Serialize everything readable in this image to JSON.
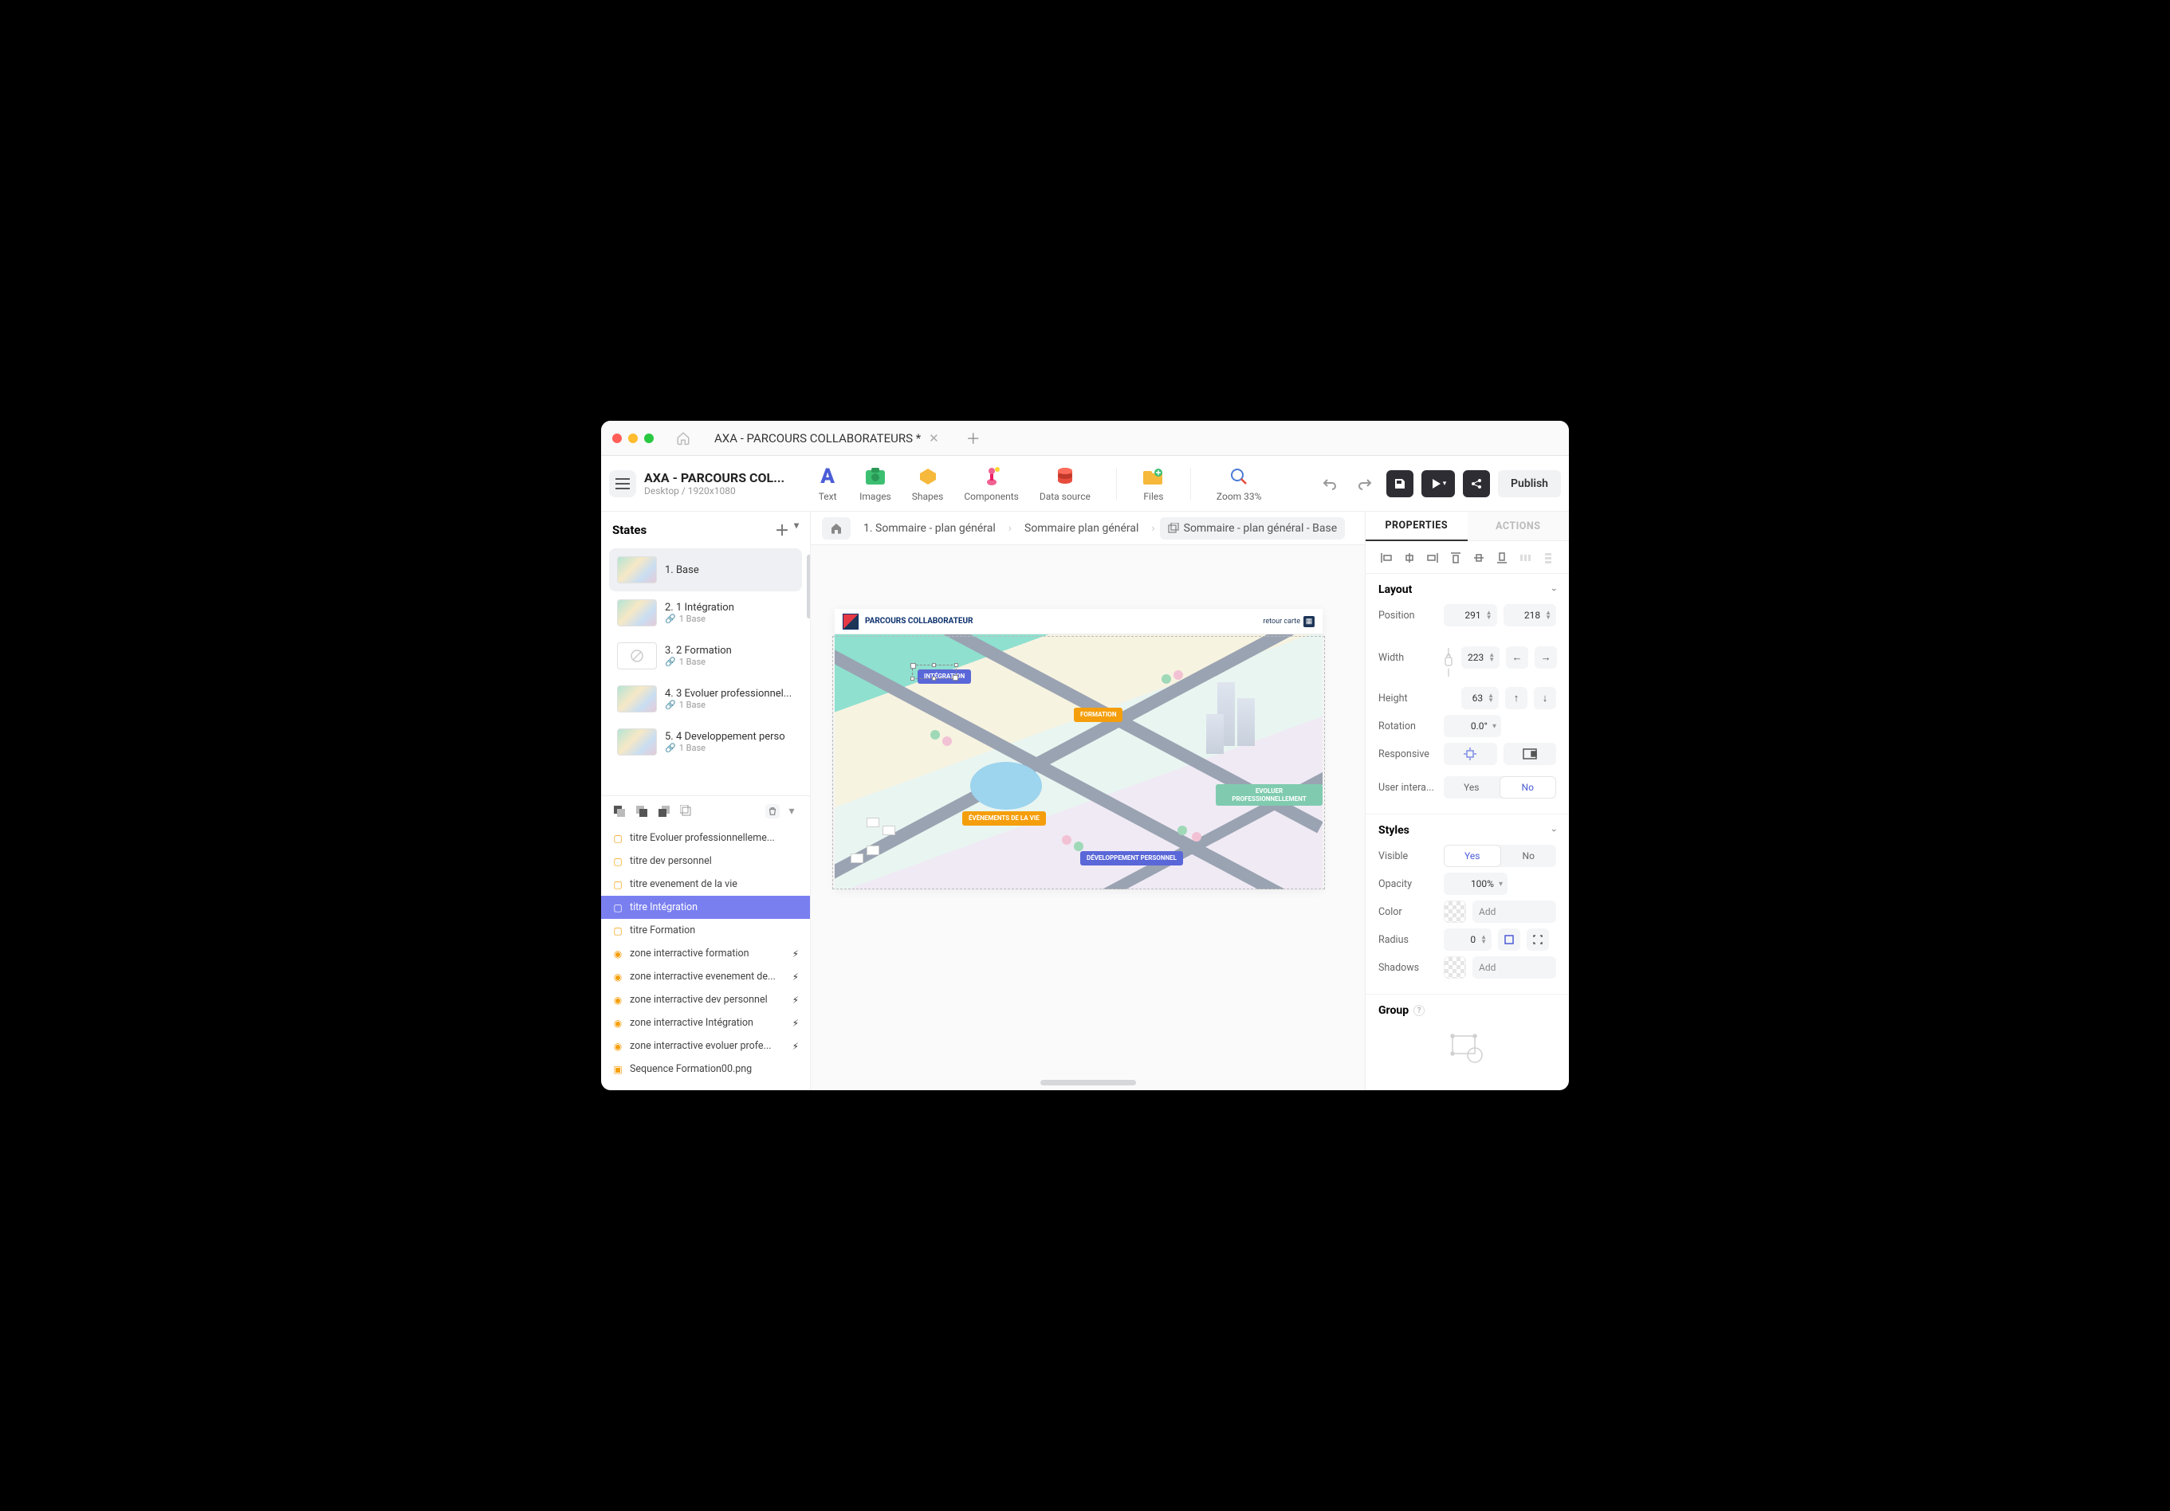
{
  "titlebar": {
    "tab_title": "AXA - PARCOURS COLLABORATEURS *"
  },
  "doc": {
    "title": "AXA - PARCOURS COL...",
    "subtitle": "Desktop / 1920x1080"
  },
  "tools": {
    "text": "Text",
    "images": "Images",
    "shapes": "Shapes",
    "components": "Components",
    "datasource": "Data source",
    "files": "Files",
    "zoom": "Zoom 33%",
    "publish": "Publish"
  },
  "breadcrumb": {
    "a": "1. Sommaire - plan général",
    "b": "Sommaire plan général",
    "c": "Sommaire - plan général  -  Base"
  },
  "states": {
    "heading": "States",
    "items": [
      {
        "name": "1. Base",
        "sub": "",
        "thumb": "map"
      },
      {
        "name": "2. 1 Intégration",
        "sub": "1  Base",
        "thumb": "map"
      },
      {
        "name": "3. 2 Formation",
        "sub": "1  Base",
        "thumb": "empty"
      },
      {
        "name": "4. 3 Evoluer professionnel...",
        "sub": "1  Base",
        "thumb": "map"
      },
      {
        "name": "5. 4 Developpement perso",
        "sub": "1  Base",
        "thumb": "map"
      }
    ]
  },
  "layers": [
    {
      "icon": "box",
      "name": "titre Evoluer professionnelleme..."
    },
    {
      "icon": "box",
      "name": "titre dev personnel"
    },
    {
      "icon": "box",
      "name": "titre evenement de la vie"
    },
    {
      "icon": "box",
      "name": "titre Intégration",
      "selected": true
    },
    {
      "icon": "box",
      "name": "titre Formation"
    },
    {
      "icon": "flame",
      "name": "zone interractive formation",
      "bolt": true
    },
    {
      "icon": "flame",
      "name": "zone interractive evenement de...",
      "bolt": true
    },
    {
      "icon": "flame",
      "name": "zone interractive dev personnel",
      "bolt": true
    },
    {
      "icon": "flame",
      "name": "zone interractive Intégration",
      "bolt": true
    },
    {
      "icon": "flame",
      "name": "zone interractive evoluer profe...",
      "bolt": true
    },
    {
      "icon": "img",
      "name": "Sequence Formation00.png"
    }
  ],
  "canvas": {
    "title": "PARCOURS COLLABORATEUR",
    "retour": "retour carte",
    "labels": {
      "integration": "INTÉGRATION",
      "formation": "FORMATION",
      "evenements": "ÉVÈNEMENTS DE LA VIE",
      "dev": "DÉVELOPPEMENT PERSONNEL",
      "evoluer": "EVOLUER PROFESSIONNELLEMENT"
    }
  },
  "rpanel": {
    "tab_properties": "PROPERTIES",
    "tab_actions": "ACTIONS",
    "layout": {
      "heading": "Layout",
      "position_label": "Position",
      "position_x": "291",
      "position_y": "218",
      "width_label": "Width",
      "width": "223",
      "height_label": "Height",
      "height": "63",
      "rotation_label": "Rotation",
      "rotation": "0.0°",
      "responsive_label": "Responsive",
      "userinter_label": "User intera...",
      "yes": "Yes",
      "no": "No"
    },
    "styles": {
      "heading": "Styles",
      "visible_label": "Visible",
      "opacity_label": "Opacity",
      "opacity": "100%",
      "color_label": "Color",
      "add": "Add",
      "radius_label": "Radius",
      "radius": "0",
      "shadows_label": "Shadows"
    },
    "group": {
      "heading": "Group"
    }
  }
}
